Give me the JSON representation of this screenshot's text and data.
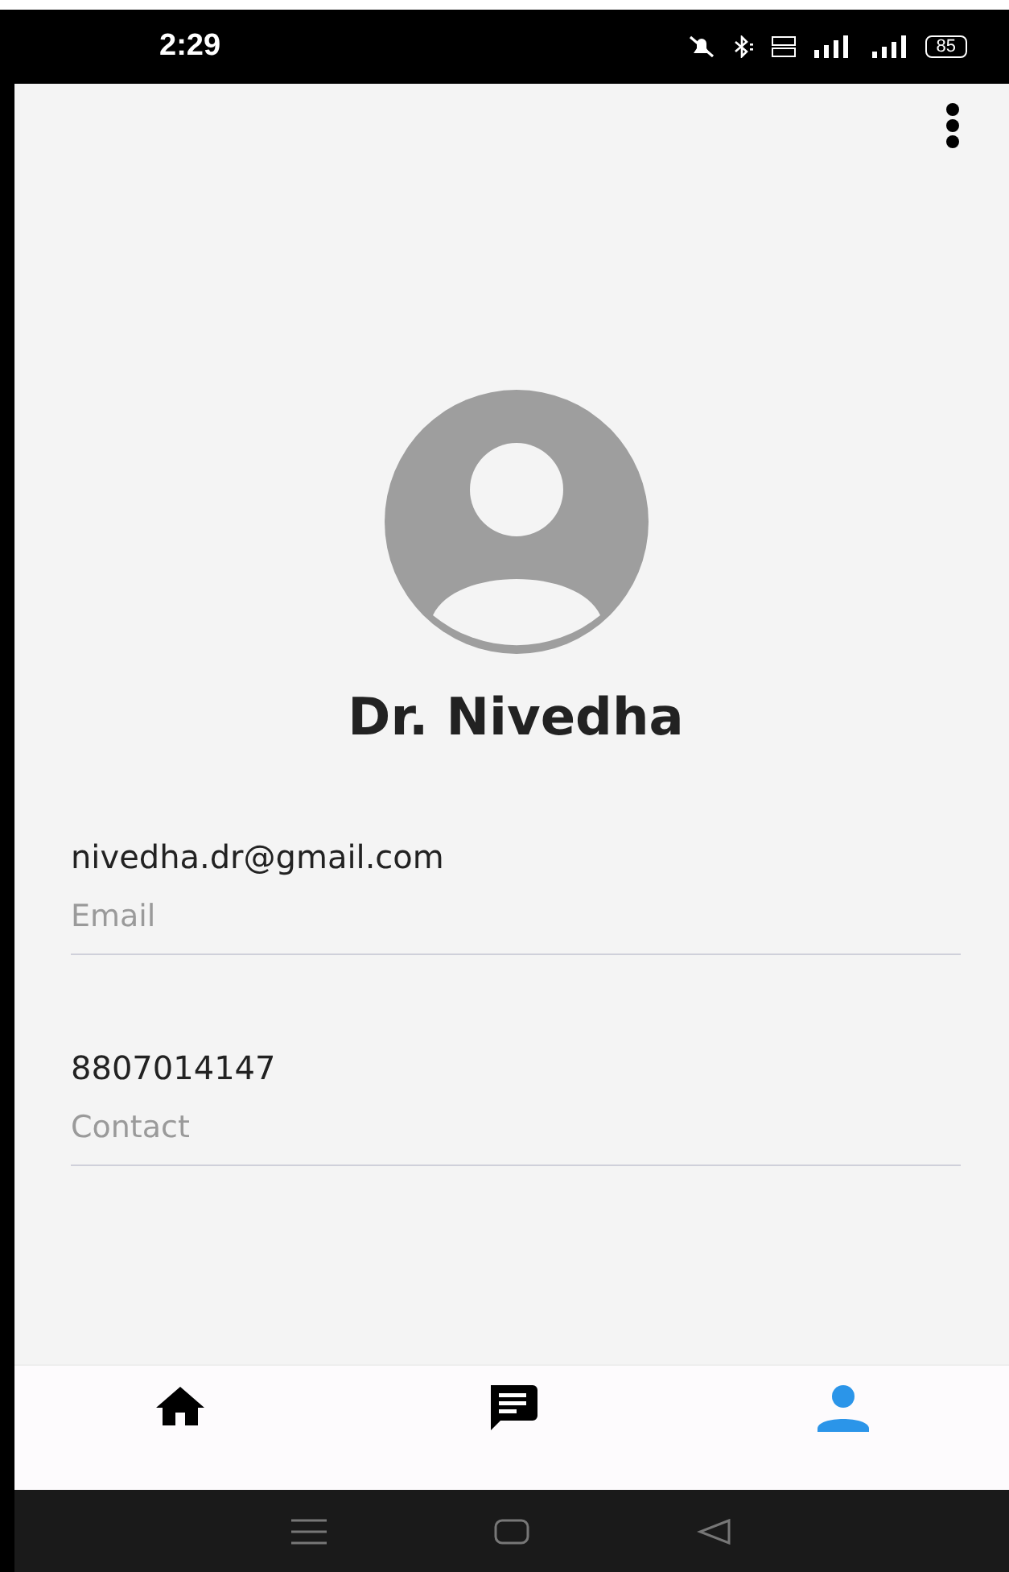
{
  "status_bar": {
    "time": "2:29",
    "battery": "85"
  },
  "profile": {
    "name": "Dr. Nivedha"
  },
  "fields": [
    {
      "value": "nivedha.dr@gmail.com",
      "label": "Email"
    },
    {
      "value": "8807014147",
      "label": "Contact"
    }
  ],
  "bottom_nav": [
    {
      "kind": "home",
      "selected": false
    },
    {
      "kind": "chat",
      "selected": false
    },
    {
      "kind": "profile",
      "selected": true
    }
  ]
}
